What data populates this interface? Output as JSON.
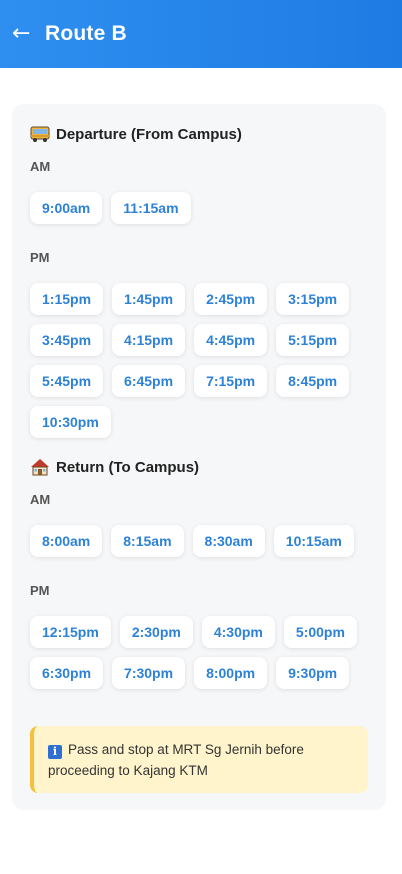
{
  "header": {
    "back_icon": "←",
    "title": "Route B"
  },
  "departure": {
    "title": "Departure (From Campus)",
    "icon": "bus-icon",
    "am_label": "AM",
    "am_times": [
      "9:00am",
      "11:15am"
    ],
    "pm_label": "PM",
    "pm_times": [
      "1:15pm",
      "1:45pm",
      "2:45pm",
      "3:15pm",
      "3:45pm",
      "4:15pm",
      "4:45pm",
      "5:15pm",
      "5:45pm",
      "6:45pm",
      "7:15pm",
      "8:45pm",
      "10:30pm"
    ]
  },
  "return": {
    "title": "Return (To Campus)",
    "icon": "house-icon",
    "am_label": "AM",
    "am_times": [
      "8:00am",
      "8:15am",
      "8:30am",
      "10:15am"
    ],
    "pm_label": "PM",
    "pm_times": [
      "12:15pm",
      "2:30pm",
      "4:30pm",
      "5:00pm",
      "6:30pm",
      "7:30pm",
      "8:00pm",
      "9:30pm"
    ]
  },
  "note": {
    "icon": "info-icon",
    "icon_glyph": "i",
    "text": "Pass and stop at MRT Sg Jernih before proceeding to Kajang KTM"
  },
  "colors": {
    "header": "#1e7be3",
    "time_text": "#2d82d7",
    "note_bg": "#fff4cc",
    "note_border": "#f5c03a"
  }
}
